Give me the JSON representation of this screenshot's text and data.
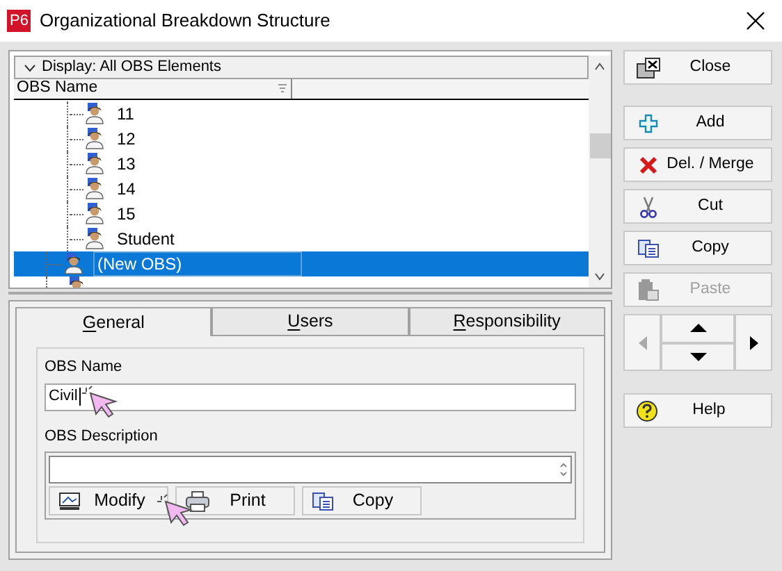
{
  "window": {
    "title": "Organizational Breakdown Structure",
    "app_badge": "P6"
  },
  "display_bar": {
    "label": "Display: All OBS Elements"
  },
  "table": {
    "columns": [
      "OBS Name"
    ]
  },
  "tree": {
    "nodes": [
      {
        "children": [
          {
            "name": "11",
            "selected": false
          },
          {
            "name": "12",
            "selected": false
          },
          {
            "name": "13",
            "selected": false
          },
          {
            "name": "14",
            "selected": false
          },
          {
            "name": "15",
            "selected": false
          },
          {
            "name": "Student",
            "selected": false
          }
        ]
      },
      {
        "name": "(New OBS)",
        "selected": true
      }
    ]
  },
  "tabs": [
    {
      "label": "General",
      "selected": true
    },
    {
      "label": "Users",
      "selected": false
    },
    {
      "label": "Responsibility",
      "selected": false
    }
  ],
  "form": {
    "name_label": "OBS Name",
    "name_value": "Civil",
    "description_label": "OBS Description",
    "buttons": [
      {
        "label": "Modify",
        "kind": "modify"
      },
      {
        "label": "Print",
        "kind": "print"
      },
      {
        "label": "Copy",
        "kind": "copy"
      }
    ]
  },
  "side_buttons": [
    {
      "label": "Close",
      "kind": "close",
      "disabled": false
    },
    {
      "label": "Add",
      "kind": "add",
      "disabled": false
    },
    {
      "label": "Del. / Merge",
      "kind": "delete",
      "disabled": false
    },
    {
      "label": "Cut",
      "kind": "cut",
      "disabled": false
    },
    {
      "label": "Copy",
      "kind": "copy",
      "disabled": false
    },
    {
      "label": "Paste",
      "kind": "paste",
      "disabled": true
    }
  ],
  "nav_buttons": [
    {
      "kind": "left",
      "disabled": true
    },
    {
      "kind": "up",
      "disabled": false
    },
    {
      "kind": "down",
      "disabled": false
    },
    {
      "kind": "right",
      "disabled": false
    }
  ],
  "help_button": {
    "label": "Help"
  }
}
